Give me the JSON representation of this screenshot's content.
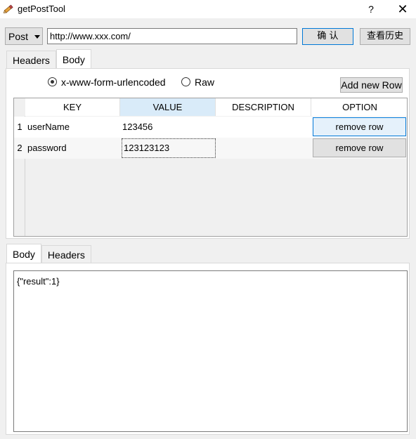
{
  "window": {
    "title": "getPostTool",
    "help_label": "?",
    "close_label": "✕",
    "icon": "pencil-icon"
  },
  "request": {
    "method": "Post",
    "url": "http://www.xxx.com/",
    "confirm_label": "确 认",
    "history_label": "查看历史"
  },
  "top_tabs": [
    {
      "label": "Headers",
      "active": false
    },
    {
      "label": "Body",
      "active": true
    }
  ],
  "body_options": {
    "urlencoded_label": "x-www-form-urlencoded",
    "raw_label": "Raw",
    "selected": "x-www-form-urlencoded",
    "add_row_label": "Add new Row"
  },
  "table": {
    "columns": [
      "KEY",
      "VALUE",
      "DESCRIPTION",
      "OPTION"
    ],
    "selected_column": "VALUE",
    "rows": [
      {
        "num": "1",
        "key": "userName",
        "value": "123456",
        "description": "",
        "option": "remove row"
      },
      {
        "num": "2",
        "key": "password",
        "value": "123123123",
        "description": "",
        "option": "remove row"
      }
    ]
  },
  "bottom_tabs": [
    {
      "label": "Body",
      "active": true
    },
    {
      "label": "Headers",
      "active": false
    }
  ],
  "response": {
    "body": "{\"result\":1}"
  },
  "colors": {
    "window_bg": "#f0f0f0",
    "accent_border": "#0078d7",
    "selected_header": "#d9ebf9"
  }
}
